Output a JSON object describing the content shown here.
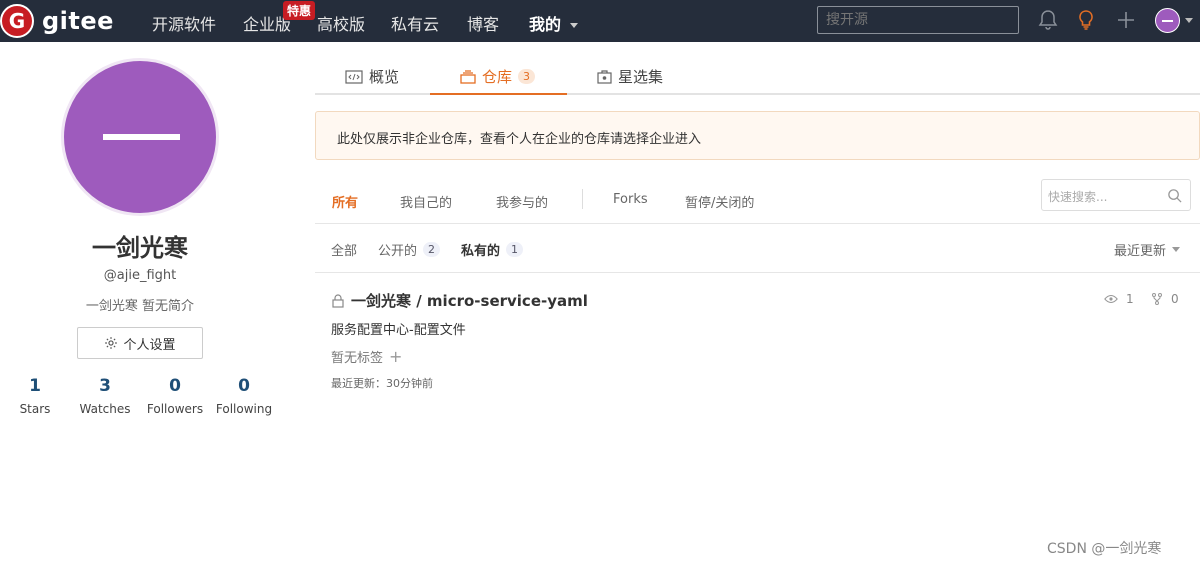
{
  "brand": {
    "logo_letter": "G",
    "name": "gitee"
  },
  "nav": {
    "items": [
      {
        "label": "开源软件"
      },
      {
        "label": "企业版"
      },
      {
        "label": "高校版"
      },
      {
        "label": "私有云"
      },
      {
        "label": "博客"
      },
      {
        "label": "我的"
      }
    ],
    "promo_badge": "特惠",
    "search_placeholder": "搜开源"
  },
  "profile": {
    "name": "一剑光寒",
    "handle": "@ajie_fight",
    "bio": "一剑光寒 暂无简介",
    "settings_label": "个人设置",
    "stats": [
      {
        "value": "1",
        "label": "Stars"
      },
      {
        "value": "3",
        "label": "Watches"
      },
      {
        "value": "0",
        "label": "Followers"
      },
      {
        "value": "0",
        "label": "Following"
      }
    ]
  },
  "tabs": [
    {
      "label": "概览"
    },
    {
      "label": "仓库",
      "count": "3"
    },
    {
      "label": "星选集"
    }
  ],
  "notice": "此处仅展示非企业仓库，查看个人在企业的仓库请选择企业进入",
  "filters": [
    {
      "label": "所有"
    },
    {
      "label": "我自己的"
    },
    {
      "label": "我参与的"
    },
    {
      "label": "Forks"
    },
    {
      "label": "暂停/关闭的"
    }
  ],
  "quick_search_placeholder": "快速搜索...",
  "sub_filters": [
    {
      "label": "全部"
    },
    {
      "label": "公开的",
      "count": "2"
    },
    {
      "label": "私有的",
      "count": "1"
    }
  ],
  "sort_label": "最近更新",
  "repo": {
    "title": "一剑光寒 / micro-service-yaml",
    "watch_count": "1",
    "fork_count": "0",
    "description": "服务配置中心-配置文件",
    "tags_label": "暂无标签",
    "tags_plus": "+",
    "updated": "最近更新：30分钟前"
  },
  "watermark": "CSDN @一剑光寒",
  "colors": {
    "topbar": "#252d3b",
    "accent": "#e46e24",
    "avatar": "#9e5bbd",
    "brand_red": "#c71d23"
  }
}
